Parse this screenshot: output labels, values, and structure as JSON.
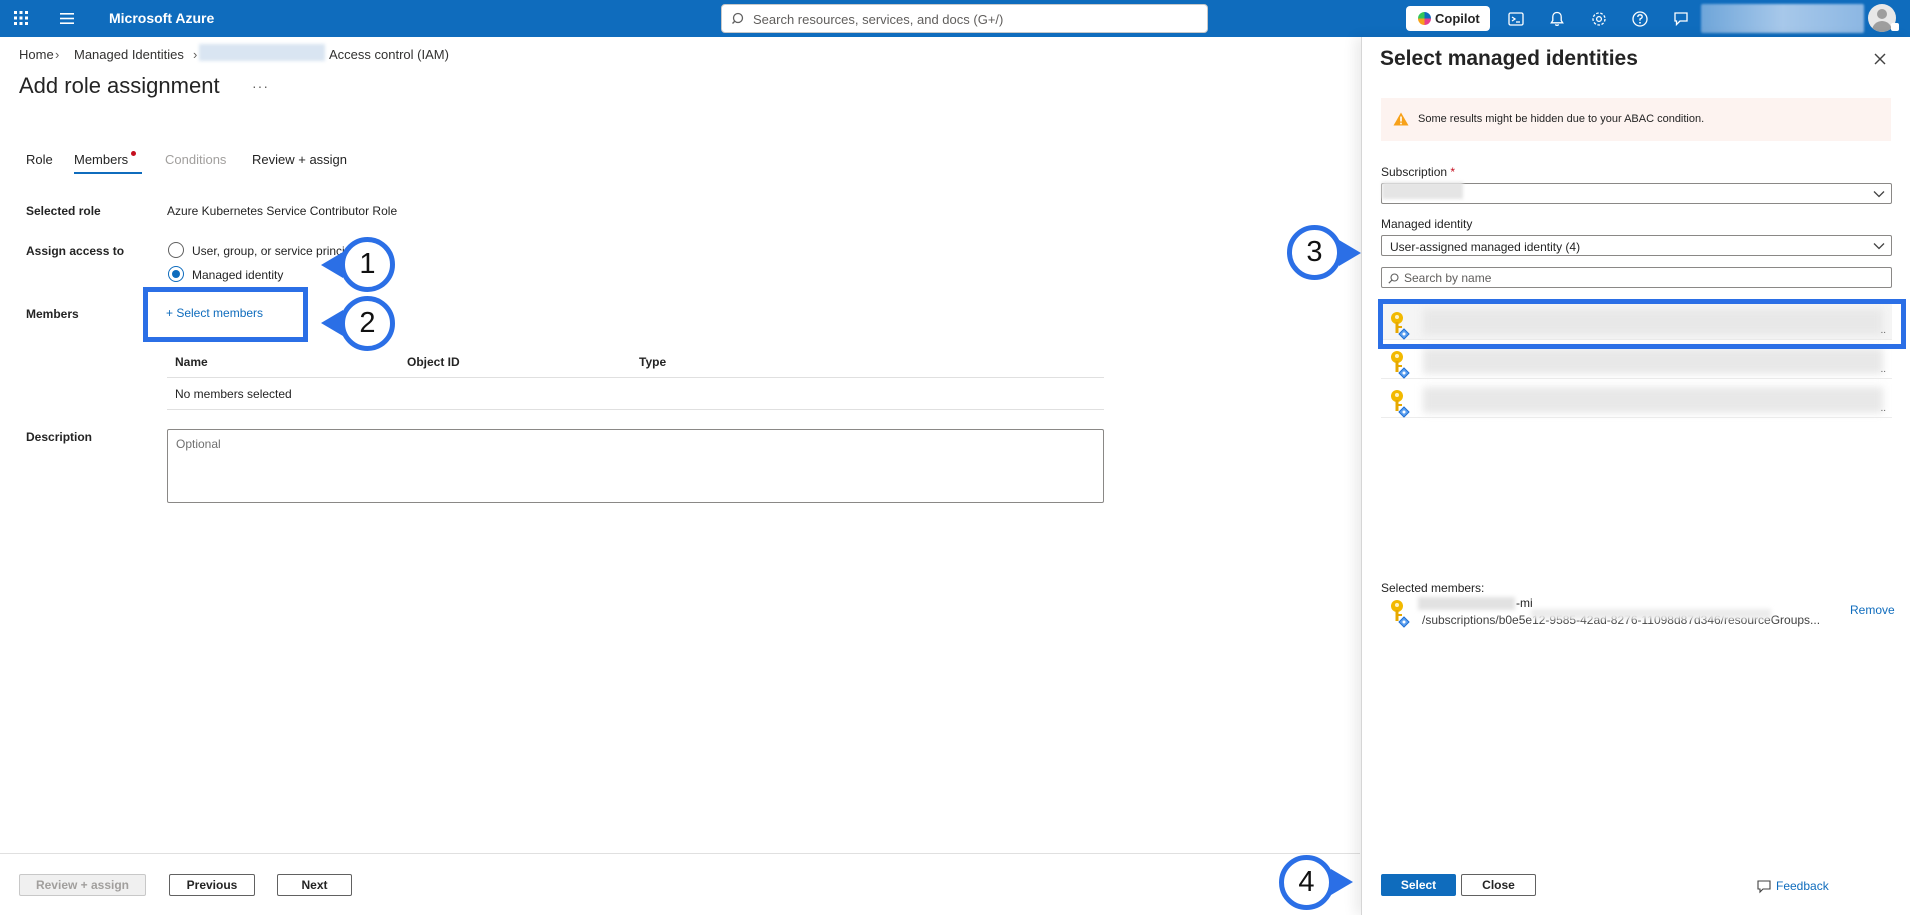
{
  "app": {
    "brand": "Microsoft Azure"
  },
  "search": {
    "placeholder": "Search resources, services, and docs (G+/)"
  },
  "topbar": {
    "copilot_label": "Copilot"
  },
  "breadcrumb": {
    "home": "Home",
    "managed_identities": "Managed Identities",
    "sep": "›",
    "iam": "Access control (IAM)"
  },
  "page": {
    "title": "Add role assignment",
    "more": "···"
  },
  "tabs": [
    {
      "label": "Role",
      "state": "normal"
    },
    {
      "label": "Members",
      "state": "active"
    },
    {
      "label": "Conditions",
      "state": "disabled"
    },
    {
      "label": "Review + assign",
      "state": "normal"
    }
  ],
  "form": {
    "selected_role_label": "Selected role",
    "selected_role_value": "Azure Kubernetes Service Contributor Role",
    "assign_access_label": "Assign access to",
    "option_user": "User, group, or service princi",
    "option_managed": "Managed identity",
    "members_label": "Members",
    "select_members": "+ Select members",
    "table_headers": [
      "Name",
      "Object ID",
      "Type"
    ],
    "empty_row": "No members selected",
    "description_label": "Description",
    "description_placeholder": "Optional"
  },
  "footer": {
    "review_assign": "Review + assign",
    "previous": "Previous",
    "next": "Next"
  },
  "panel": {
    "title": "Select managed identities",
    "warning": "Some results might be hidden due to your ABAC condition.",
    "subscription_label": "Subscription",
    "required_mark": "*",
    "managed_identity_label": "Managed identity",
    "managed_identity_value": "User-assigned managed identity (4)",
    "search_placeholder": "Search by name",
    "item_ellipsis": "..",
    "selected_members_label": "Selected members:",
    "selected_member_name_suffix": "-mi",
    "selected_member_path": "/subscriptions/b0e5e12-9585-42ad-8276-11098d87d346/resourceGroups...",
    "remove": "Remove",
    "select_button": "Select",
    "close_button": "Close",
    "feedback": "Feedback"
  },
  "callouts": [
    "1",
    "2",
    "3",
    "4"
  ],
  "colors": {
    "azure_blue": "#0f6cbd",
    "callout_blue": "#2b6fe6",
    "warning_bg": "#fdf3f0",
    "warning_icon": "#f7a11a"
  }
}
